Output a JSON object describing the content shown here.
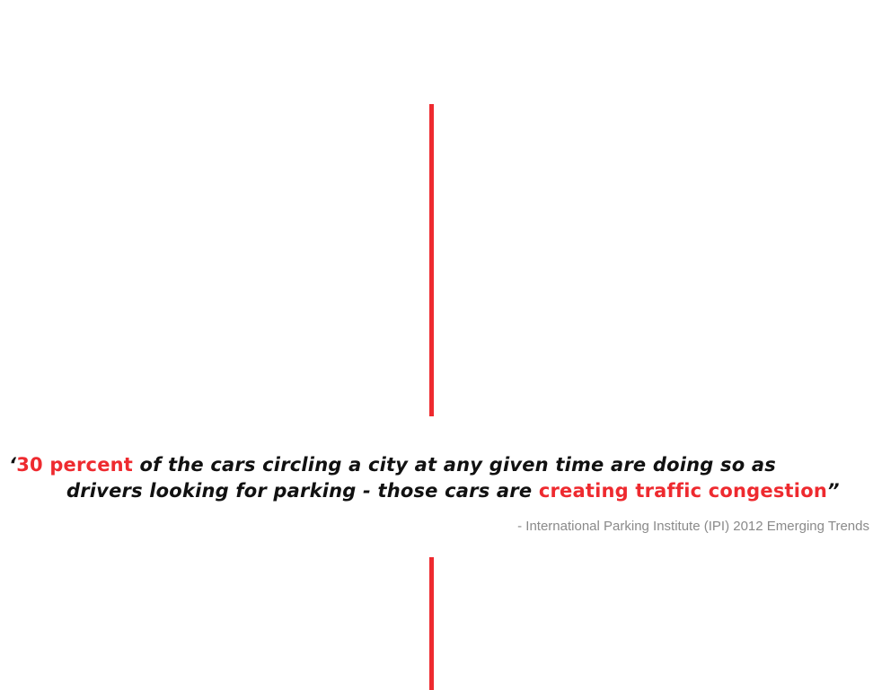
{
  "quote": {
    "open_mark": "‘",
    "highlight_1": "30 percent",
    "text_1": " of the cars circling a city at any given time are doing so as",
    "text_2": "drivers looking for parking - those cars are ",
    "highlight_2": "creating traffic congestion",
    "close_mark": "”"
  },
  "attribution": "- International Parking Institute (IPI) 2012 Emerging Trends",
  "colors": {
    "accent": "#ee2a2f",
    "text": "#111111",
    "attribution": "#8a8a8a"
  }
}
